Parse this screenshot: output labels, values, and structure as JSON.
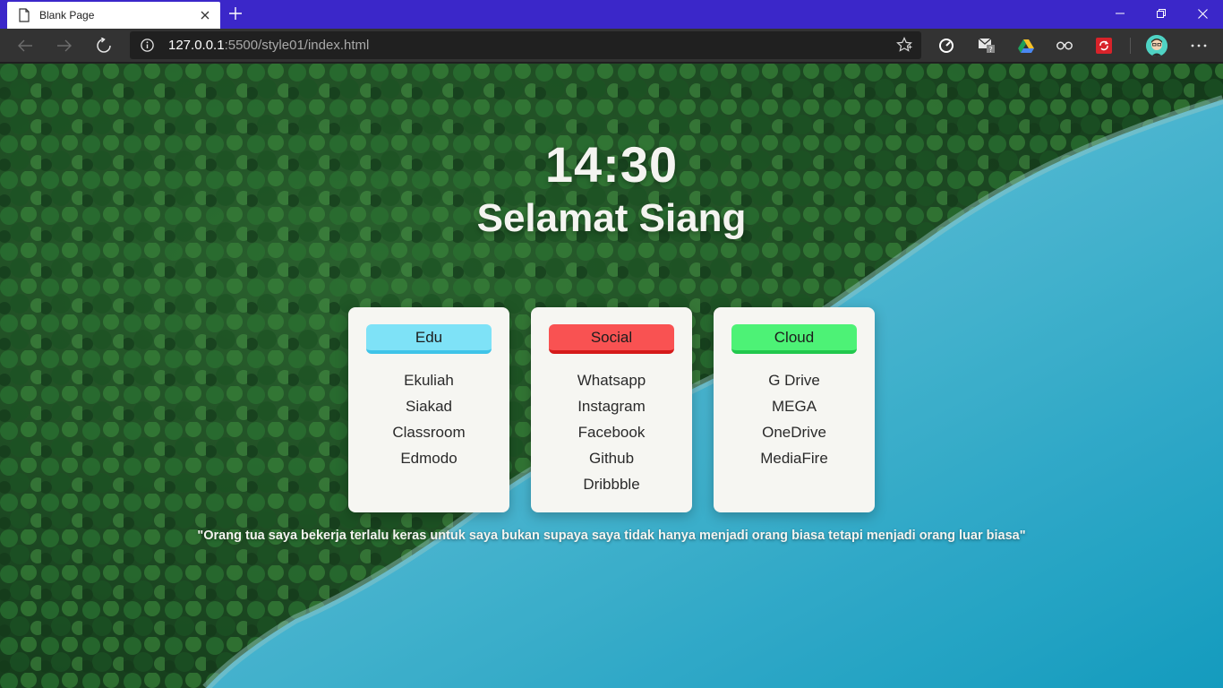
{
  "browser": {
    "tab_title": "Blank Page",
    "url_host": "127.0.0.1",
    "url_rest": ":5500/style01/index.html",
    "accent_color": "#3b27c9"
  },
  "page": {
    "clock": "14:30",
    "greeting": "Selamat Siang",
    "cards": {
      "edu": {
        "title": "Edu",
        "color": "#7ee2f7",
        "links": [
          "Ekuliah",
          "Siakad",
          "Classroom",
          "Edmodo"
        ]
      },
      "social": {
        "title": "Social",
        "color": "#f95252",
        "links": [
          "Whatsapp",
          "Instagram",
          "Facebook",
          "Github",
          "Dribbble"
        ]
      },
      "cloud": {
        "title": "Cloud",
        "color": "#4df276",
        "links": [
          "G Drive",
          "MEGA",
          "OneDrive",
          "MediaFire"
        ]
      }
    },
    "quote": "\"Orang tua saya bekerja terlalu keras untuk saya bukan supaya saya tidak hanya menjadi orang biasa tetapi menjadi orang luar biasa\""
  }
}
